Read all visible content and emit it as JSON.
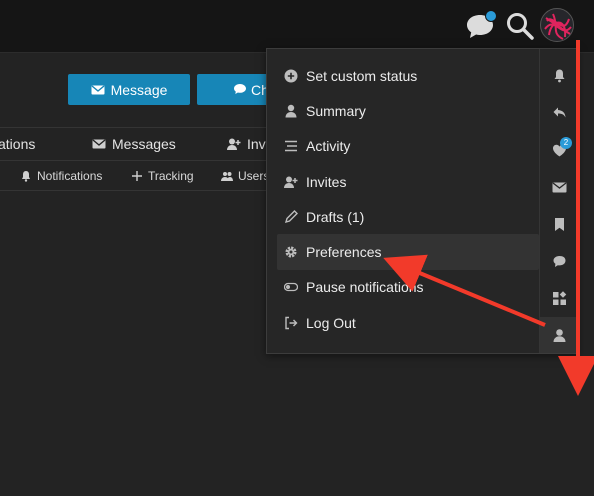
{
  "buttons": {
    "message": "Message",
    "chat": "Ch"
  },
  "tabs": [
    {
      "label": "ations",
      "icon": "none"
    },
    {
      "label": "Messages",
      "icon": "envelope-icon"
    },
    {
      "label": "Invi",
      "icon": "user-plus-icon"
    }
  ],
  "subtabs": [
    {
      "label": "Notifications",
      "icon": "bell-icon"
    },
    {
      "label": "Tracking",
      "icon": "plus-icon"
    },
    {
      "label": "Users",
      "icon": "users-icon"
    }
  ],
  "menu": {
    "items": [
      {
        "label": "Set custom status",
        "icon": "plus-circle-icon"
      },
      {
        "label": "Summary",
        "icon": "user-icon"
      },
      {
        "label": "Activity",
        "icon": "list-icon"
      },
      {
        "label": "Invites",
        "icon": "user-plus-icon"
      },
      {
        "label": "Drafts (1)",
        "icon": "pencil-icon"
      },
      {
        "label": "Preferences",
        "icon": "gear-icon",
        "active": true
      },
      {
        "label": "Pause notifications",
        "icon": "toggle-icon"
      },
      {
        "label": "Log Out",
        "icon": "sign-out-icon"
      }
    ],
    "rail_badge": "2",
    "rail_icons": [
      "bell-icon",
      "reply-icon",
      "heart-icon",
      "envelope-icon",
      "bookmark-icon",
      "chat-icon",
      "widgets-icon",
      "user-icon"
    ]
  },
  "colors": {
    "accent": "#1786b7",
    "badge": "#2a9bd8",
    "annotation": "#f23a2a"
  }
}
